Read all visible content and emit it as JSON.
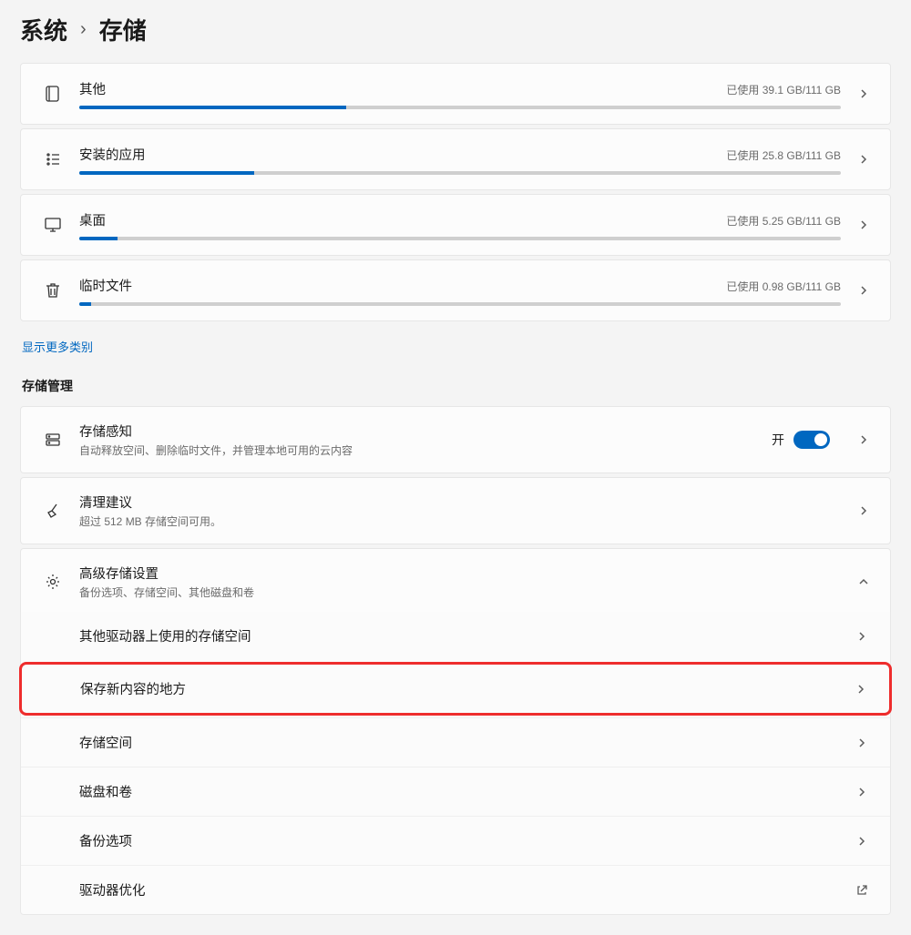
{
  "breadcrumb": {
    "parent": "系统",
    "current": "存储"
  },
  "categories": [
    {
      "icon": "other",
      "title": "其他",
      "usage": "已使用 39.1 GB/111 GB",
      "percent": 35
    },
    {
      "icon": "apps",
      "title": "安装的应用",
      "usage": "已使用 25.8 GB/111 GB",
      "percent": 23
    },
    {
      "icon": "desktop",
      "title": "桌面",
      "usage": "已使用 5.25 GB/111 GB",
      "percent": 5
    },
    {
      "icon": "trash",
      "title": "临时文件",
      "usage": "已使用 0.98 GB/111 GB",
      "percent": 1
    }
  ],
  "show_more": "显示更多类别",
  "mgmt_header": "存储管理",
  "mgmt": {
    "sense": {
      "title": "存储感知",
      "sub": "自动释放空间、删除临时文件，并管理本地可用的云内容",
      "toggle_label": "开"
    },
    "cleanup": {
      "title": "清理建议",
      "sub": "超过 512 MB 存储空间可用。"
    },
    "advanced": {
      "title": "高级存储设置",
      "sub": "备份选项、存储空间、其他磁盘和卷"
    }
  },
  "advanced_items": [
    {
      "label": "其他驱动器上使用的存储空间",
      "tail": "chevron"
    },
    {
      "label": "保存新内容的地方",
      "tail": "chevron",
      "highlight": true
    },
    {
      "label": "存储空间",
      "tail": "chevron"
    },
    {
      "label": "磁盘和卷",
      "tail": "chevron"
    },
    {
      "label": "备份选项",
      "tail": "chevron"
    },
    {
      "label": "驱动器优化",
      "tail": "external"
    }
  ]
}
